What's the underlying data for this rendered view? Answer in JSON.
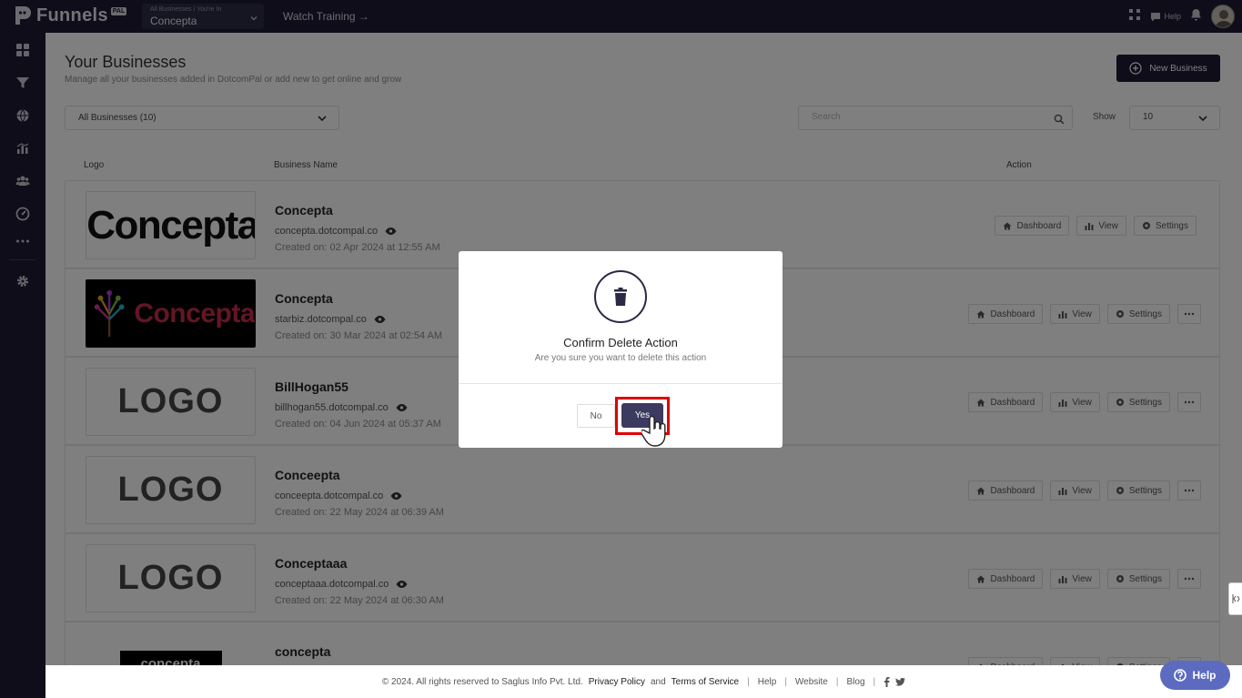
{
  "brand": {
    "name": "Funnels",
    "badge": "PAL"
  },
  "business_select": {
    "caption": "All Businesses / You're In",
    "value": "Concepta"
  },
  "topbar": {
    "watch_training": "Watch Training →",
    "help": "Help"
  },
  "page": {
    "title": "Your Businesses",
    "subtitle": "Manage all your businesses added in DotcomPal or add new to get online and grow",
    "new_business": "New Business"
  },
  "filters": {
    "businesses": "All Businesses (10)",
    "search_placeholder": "Search",
    "show_label": "Show",
    "show_value": "10"
  },
  "table": {
    "headers": {
      "logo": "Logo",
      "name": "Business Name",
      "action": "Action"
    },
    "rows": [
      {
        "name": "Concepta",
        "url": "concepta.dotcompal.co",
        "created": "Created on: 02 Apr 2024 at 12:55 AM",
        "logo": "Concepta"
      },
      {
        "name": "Concepta",
        "url": "starbiz.dotcompal.co",
        "created": "Created on: 30 Mar 2024 at 02:54 AM",
        "logo": "Concepta"
      },
      {
        "name": "BillHogan55",
        "url": "billhogan55.dotcompal.co",
        "created": "Created on: 04 Jun 2024 at 05:37 AM",
        "logo": "LOGO"
      },
      {
        "name": "Conceepta",
        "url": "conceepta.dotcompal.co",
        "created": "Created on: 22 May 2024 at 06:39 AM",
        "logo": "LOGO"
      },
      {
        "name": "Conceptaaa",
        "url": "conceptaaa.dotcompal.co",
        "created": "Created on: 22 May 2024 at 06:30 AM",
        "logo": "LOGO"
      },
      {
        "name": "concepta",
        "url": "",
        "created": "",
        "logo": "concepta"
      }
    ],
    "actions": {
      "dashboard": "Dashboard",
      "view": "View",
      "settings": "Settings"
    }
  },
  "modal": {
    "title": "Confirm Delete Action",
    "message": "Are you sure you want to delete this action",
    "no": "No",
    "yes": "Yes"
  },
  "footer": {
    "copyright": "© 2024. All rights reserved to Saglus Info Pvt. Ltd.",
    "privacy": "Privacy Policy",
    "and": "and",
    "terms": "Terms of Service",
    "links": [
      "Help",
      "Website",
      "Blog"
    ]
  },
  "help_fab": "Help",
  "colors": {
    "dark": "#1d1b33",
    "primary_button": "#3c3a5f",
    "highlight": "#e00000",
    "help_fab": "#5c6bc0"
  }
}
